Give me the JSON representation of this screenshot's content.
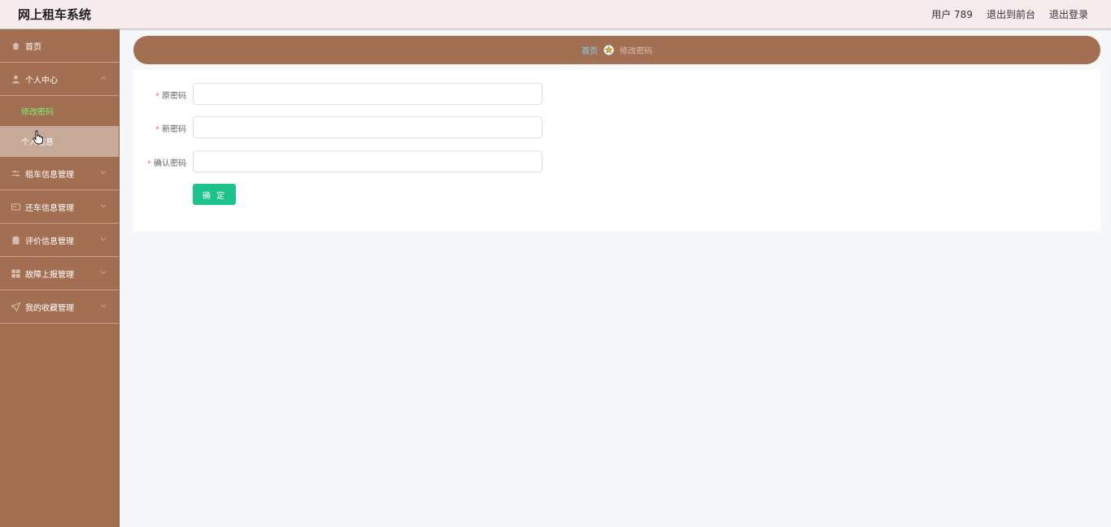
{
  "header": {
    "app_title": "网上租车系统",
    "user_label": "用户 789",
    "exit_front": "退出到前台",
    "logout": "退出登录"
  },
  "sidebar": {
    "items": [
      {
        "label": "首页",
        "icon": "home-icon"
      },
      {
        "label": "个人中心",
        "icon": "user-icon",
        "expanded": true,
        "children": [
          "修改密码",
          "个人信息"
        ]
      },
      {
        "label": "租车信息管理",
        "icon": "sliders-icon"
      },
      {
        "label": "还车信息管理",
        "icon": "card-icon"
      },
      {
        "label": "评价信息管理",
        "icon": "clipboard-icon"
      },
      {
        "label": "故障上报管理",
        "icon": "grid-icon"
      },
      {
        "label": "我的收藏管理",
        "icon": "send-icon"
      }
    ]
  },
  "breadcrumb": {
    "home": "首页",
    "current": "修改密码"
  },
  "form": {
    "old_password_label": "原密码",
    "new_password_label": "新密码",
    "confirm_password_label": "确认密码",
    "required_mark": "*",
    "submit_label": "确 定"
  },
  "colors": {
    "sidebar_bg": "#a36f53",
    "header_bg": "#f7eced",
    "button_green": "#1ec28b",
    "active_submenu": "#7cf26b"
  }
}
